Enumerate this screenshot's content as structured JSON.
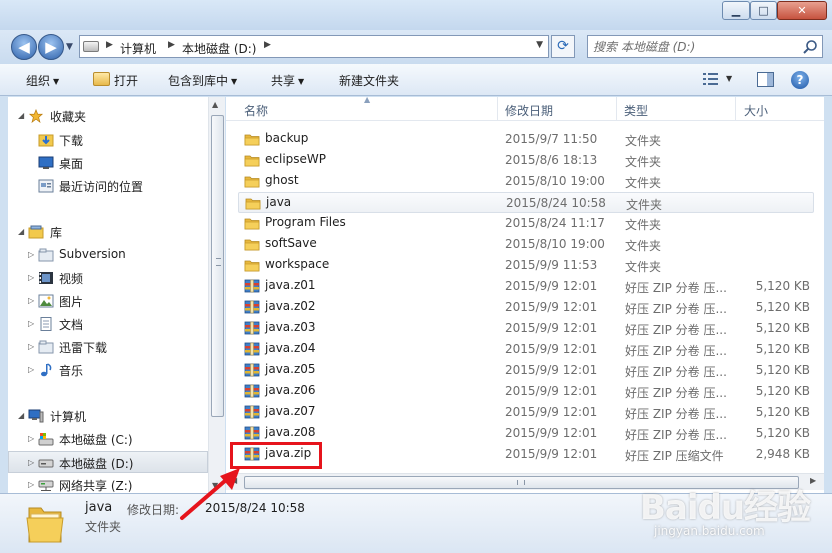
{
  "window": {
    "minimize_glyph": "▁",
    "maximize_glyph": "□",
    "close_glyph": "✕"
  },
  "address_bar": {
    "crumbs": [
      "计算机",
      "本地磁盘 (D:)"
    ],
    "search_placeholder": "搜索 本地磁盘 (D:)"
  },
  "toolbar": {
    "organize": "组织",
    "open": "打开",
    "include_in_library": "包含到库中",
    "share": "共享",
    "new_folder": "新建文件夹"
  },
  "nav_pane": {
    "favorites": {
      "label": "收藏夹",
      "items": [
        "下载",
        "桌面",
        "最近访问的位置"
      ]
    },
    "libraries": {
      "label": "库",
      "items": [
        "Subversion",
        "视频",
        "图片",
        "文档",
        "迅雷下载",
        "音乐"
      ]
    },
    "computer": {
      "label": "计算机",
      "items": [
        "本地磁盘 (C:)",
        "本地磁盘 (D:)",
        "网络共享 (Z:)"
      ]
    }
  },
  "file_list": {
    "columns": [
      "名称",
      "修改日期",
      "类型",
      "大小"
    ],
    "rows": [
      {
        "name": "backup",
        "date": "2015/9/7 11:50",
        "type": "文件夹",
        "size": "",
        "kind": "folder"
      },
      {
        "name": "eclipseWP",
        "date": "2015/8/6 18:13",
        "type": "文件夹",
        "size": "",
        "kind": "folder"
      },
      {
        "name": "ghost",
        "date": "2015/8/10 19:00",
        "type": "文件夹",
        "size": "",
        "kind": "folder"
      },
      {
        "name": "java",
        "date": "2015/8/24 10:58",
        "type": "文件夹",
        "size": "",
        "kind": "folder"
      },
      {
        "name": "Program Files",
        "date": "2015/8/24 11:17",
        "type": "文件夹",
        "size": "",
        "kind": "folder"
      },
      {
        "name": "softSave",
        "date": "2015/8/10 19:00",
        "type": "文件夹",
        "size": "",
        "kind": "folder"
      },
      {
        "name": "workspace",
        "date": "2015/9/9 11:53",
        "type": "文件夹",
        "size": "",
        "kind": "folder"
      },
      {
        "name": "java.z01",
        "date": "2015/9/9 12:01",
        "type": "好压 ZIP 分卷 压...",
        "size": "5,120 KB",
        "kind": "archive"
      },
      {
        "name": "java.z02",
        "date": "2015/9/9 12:01",
        "type": "好压 ZIP 分卷 压...",
        "size": "5,120 KB",
        "kind": "archive"
      },
      {
        "name": "java.z03",
        "date": "2015/9/9 12:01",
        "type": "好压 ZIP 分卷 压...",
        "size": "5,120 KB",
        "kind": "archive"
      },
      {
        "name": "java.z04",
        "date": "2015/9/9 12:01",
        "type": "好压 ZIP 分卷 压...",
        "size": "5,120 KB",
        "kind": "archive"
      },
      {
        "name": "java.z05",
        "date": "2015/9/9 12:01",
        "type": "好压 ZIP 分卷 压...",
        "size": "5,120 KB",
        "kind": "archive"
      },
      {
        "name": "java.z06",
        "date": "2015/9/9 12:01",
        "type": "好压 ZIP 分卷 压...",
        "size": "5,120 KB",
        "kind": "archive"
      },
      {
        "name": "java.z07",
        "date": "2015/9/9 12:01",
        "type": "好压 ZIP 分卷 压...",
        "size": "5,120 KB",
        "kind": "archive"
      },
      {
        "name": "java.z08",
        "date": "2015/9/9 12:01",
        "type": "好压 ZIP 分卷 压...",
        "size": "5,120 KB",
        "kind": "archive"
      },
      {
        "name": "java.zip",
        "date": "2015/9/9 12:01",
        "type": "好压 ZIP 压缩文件",
        "size": "2,948 KB",
        "kind": "archive"
      }
    ]
  },
  "details_pane": {
    "name": "java",
    "date_label": "修改日期:",
    "date_value": "2015/8/24 10:58",
    "type": "文件夹"
  },
  "watermark": {
    "logo": "Baidu经验",
    "sub": "jingyan.baidu.com"
  },
  "colors": {
    "accent_red": "#e6141c",
    "folder_yellow": "#f2c94c",
    "window_frame": "#cfe0f1"
  }
}
